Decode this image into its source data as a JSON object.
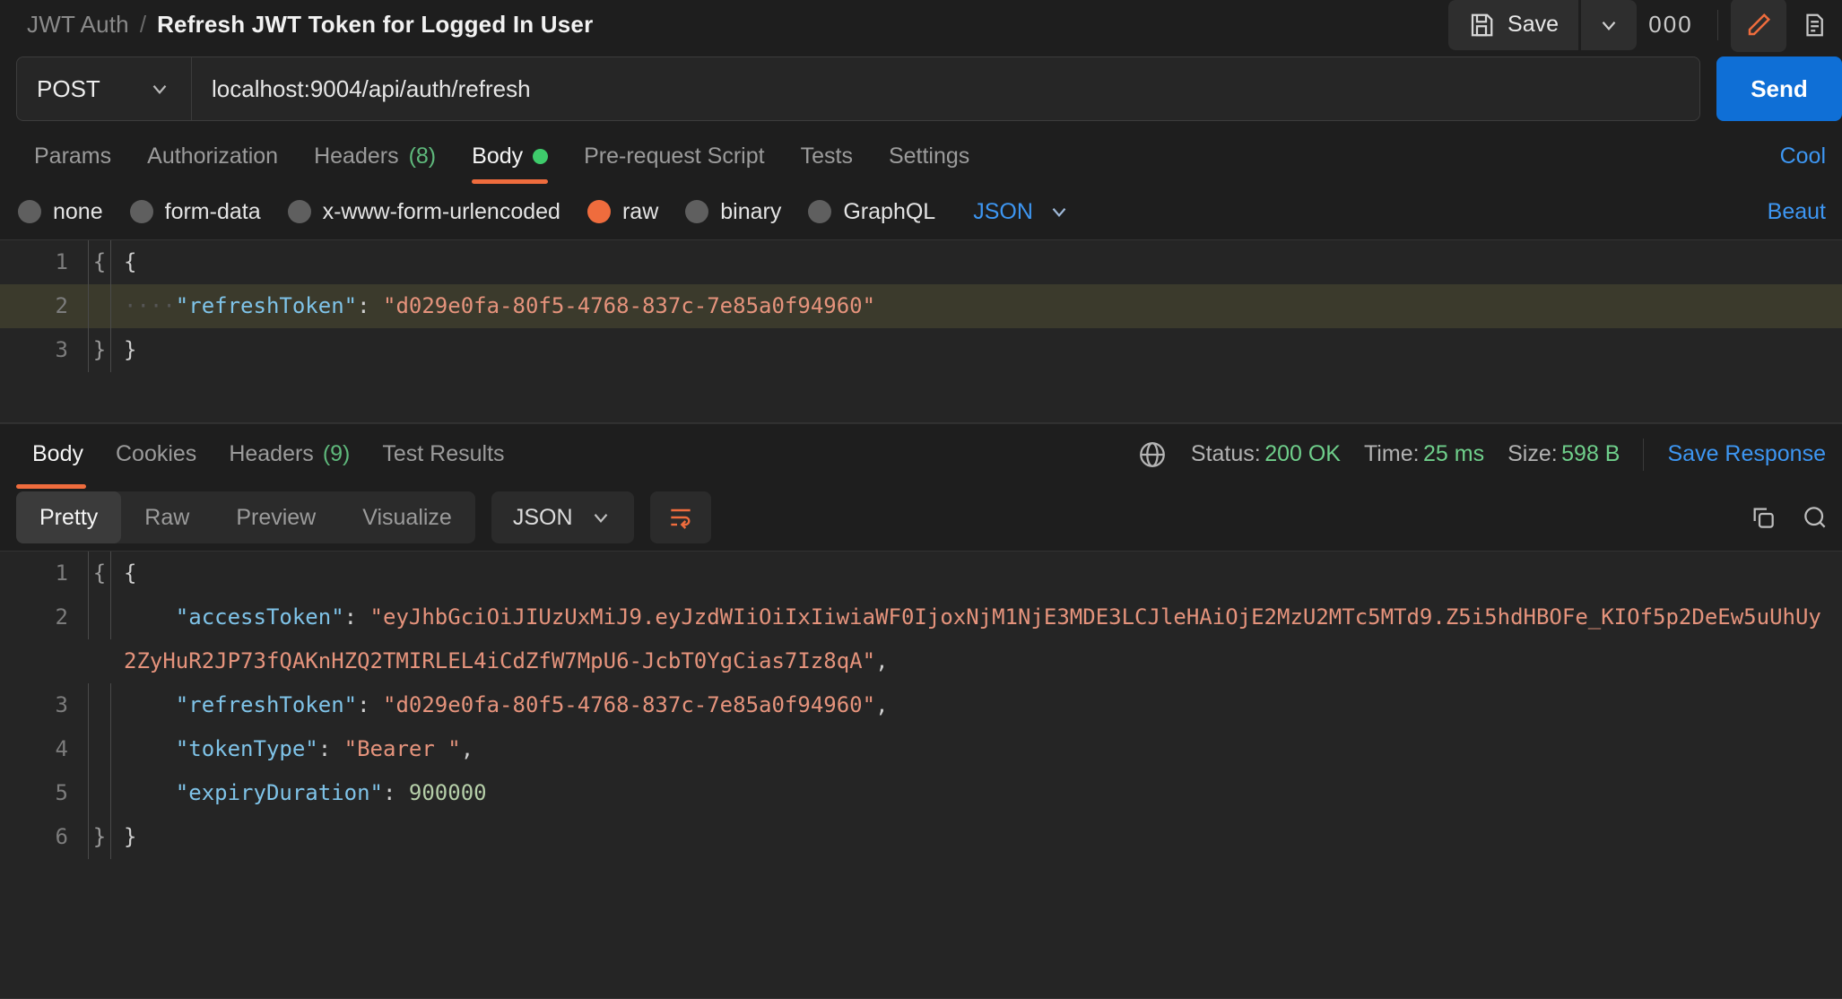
{
  "header": {
    "collection": "JWT Auth",
    "separator": "/",
    "request_title": "Refresh JWT Token for Logged In User",
    "save_label": "Save",
    "more_label": "000"
  },
  "url_bar": {
    "method": "POST",
    "url": "localhost:9004/api/auth/refresh",
    "send_label": "Send"
  },
  "request_tabs": {
    "items": [
      {
        "label": "Params"
      },
      {
        "label": "Authorization"
      },
      {
        "label": "Headers",
        "count": "(8)"
      },
      {
        "label": "Body"
      },
      {
        "label": "Pre-request Script"
      },
      {
        "label": "Tests"
      },
      {
        "label": "Settings"
      }
    ],
    "cookies_link": "Cool"
  },
  "body_type": {
    "options": [
      {
        "label": "none",
        "selected": false
      },
      {
        "label": "form-data",
        "selected": false
      },
      {
        "label": "x-www-form-urlencoded",
        "selected": false
      },
      {
        "label": "raw",
        "selected": true
      },
      {
        "label": "binary",
        "selected": false
      },
      {
        "label": "GraphQL",
        "selected": false
      }
    ],
    "format": "JSON",
    "beautify_label": "Beaut"
  },
  "request_body": {
    "lines": [
      {
        "no": "1",
        "fold": "{",
        "open": "{"
      },
      {
        "no": "2",
        "indent": "····",
        "key": "\"refreshToken\"",
        "colon": ": ",
        "value": "\"d029e0fa-80f5-4768-837c-7e85a0f94960\""
      },
      {
        "no": "3",
        "fold": "}",
        "close": "}"
      }
    ]
  },
  "response_tabs": {
    "items": [
      {
        "label": "Body"
      },
      {
        "label": "Cookies"
      },
      {
        "label": "Headers",
        "count": "(9)"
      },
      {
        "label": "Test Results"
      }
    ]
  },
  "response_meta": {
    "status_label": "Status:",
    "status_value": "200 OK",
    "time_label": "Time:",
    "time_value": "25 ms",
    "size_label": "Size:",
    "size_value": "598 B",
    "save_response": "Save Response"
  },
  "response_toolbar": {
    "views": [
      {
        "label": "Pretty",
        "active": true
      },
      {
        "label": "Raw",
        "active": false
      },
      {
        "label": "Preview",
        "active": false
      },
      {
        "label": "Visualize",
        "active": false
      }
    ],
    "format": "JSON"
  },
  "response_body": {
    "lines": [
      {
        "no": "1",
        "fold": "{",
        "text": "{"
      },
      {
        "no": "2",
        "key": "\"accessToken\"",
        "value": "\"eyJhbGciOiJIUzUxMiJ9.eyJzdWIiOiIxIiwiaWF0IjoxNjM1NjE3MDE3LCJleHAiOjE2MzU2MTc5MTd9.Z5i5hdHBOFe_KIOf5p2DeEw5uUhUy2ZyHuR2JP73fQAKnHZQ2TMIRLEL4iCdZfW7MpU6-JcbT0YgCias7Iz8qA\"",
        "trail": ","
      },
      {
        "no": "3",
        "key": "\"refreshToken\"",
        "value": "\"d029e0fa-80f5-4768-837c-7e85a0f94960\"",
        "trail": ","
      },
      {
        "no": "4",
        "key": "\"tokenType\"",
        "value": "\"Bearer \"",
        "trail": ","
      },
      {
        "no": "5",
        "key": "\"expiryDuration\"",
        "number": "900000",
        "trail": ""
      },
      {
        "no": "6",
        "fold": "}",
        "text": "}"
      }
    ]
  },
  "colors": {
    "accent_orange": "#ef6c3d",
    "link_blue": "#3d96f2",
    "send_blue": "#0f6fd6",
    "green": "#6fcf8b",
    "bg": "#1e1e1e",
    "editor_bg": "#252525"
  },
  "icons": {
    "save": "floppy-disk-icon",
    "caret": "chevron-down-icon",
    "more": "ellipsis-icon",
    "edit": "pencil-icon",
    "doc": "document-icon",
    "globe": "globe-icon",
    "wrap": "wrap-text-icon",
    "copy": "copy-icon",
    "search": "search-icon"
  }
}
